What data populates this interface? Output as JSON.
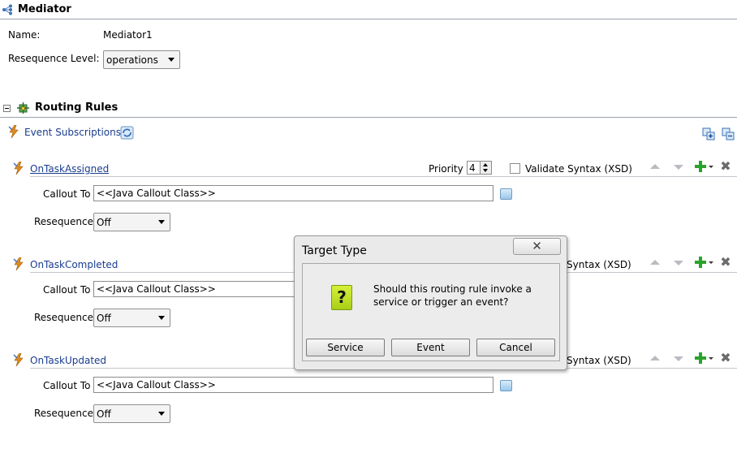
{
  "header": {
    "title": "Mediator"
  },
  "name_row": {
    "label": "Name:",
    "value": "Mediator1"
  },
  "resequence_level": {
    "label": "Resequence Level:",
    "value": "operations"
  },
  "routing_rules": {
    "title": "Routing Rules",
    "event_subscriptions": "Event Subscriptions"
  },
  "common": {
    "priority_label": "Priority",
    "validate_label": "Validate Syntax (XSD)",
    "callout_label": "Callout To",
    "callout_value": "<<Java Callout Class>>",
    "resequence_label": "Resequence",
    "resequence_value": "Off"
  },
  "rules": [
    {
      "name": "OnTaskAssigned",
      "priority": "4"
    },
    {
      "name": "OnTaskCompleted",
      "priority": ""
    },
    {
      "name": "OnTaskUpdated",
      "priority": ""
    }
  ],
  "partial": {
    "validate_suffix": "Syntax (XSD)"
  },
  "dialog": {
    "title": "Target Type",
    "close_glyph": "✕",
    "icon": "?",
    "message_line1": "Should this routing rule invoke a",
    "message_line2": "service or trigger an event?",
    "buttons": {
      "service": "Service",
      "event": "Event",
      "cancel": "Cancel"
    }
  },
  "colors": {
    "link": "#1a3c8f",
    "accent_green": "#2aa32a",
    "bolt_orange": "#e08a1e",
    "divider": "#9aa3ad"
  }
}
